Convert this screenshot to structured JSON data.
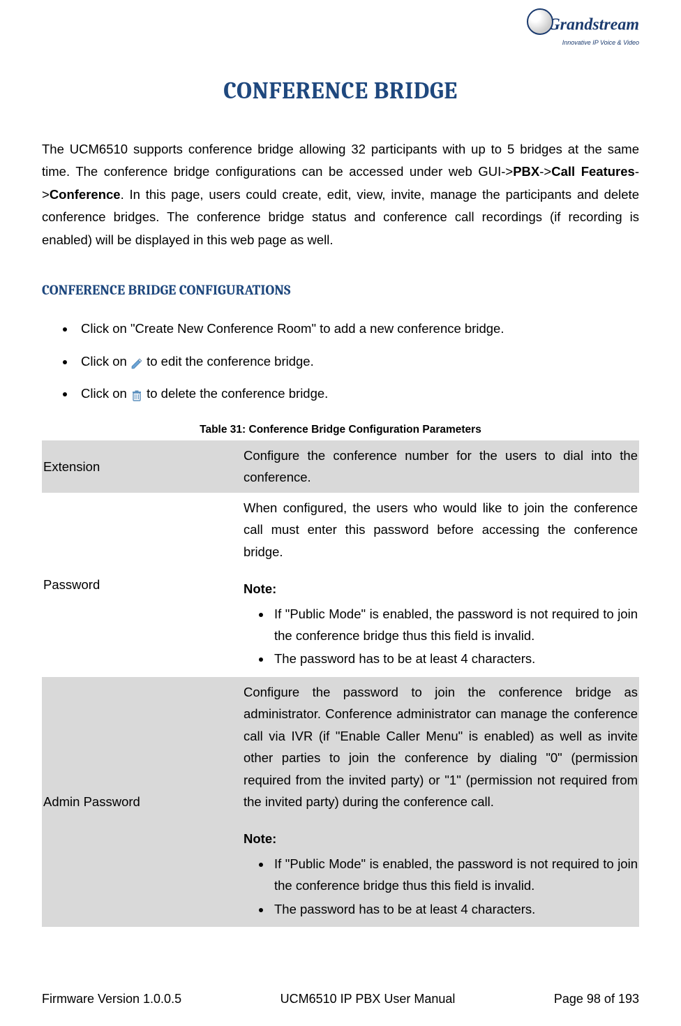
{
  "logo": {
    "brand": "Grandstream",
    "tag": "Innovative IP Voice & Video"
  },
  "title": "CONFERENCE BRIDGE",
  "intro": {
    "raw": "The UCM6510 supports conference bridge allowing 32 participants with up to 5 bridges at the same time. The conference bridge configurations can be accessed under web GUI->PBX->Call Features->Conference. In this page, users could create, edit, view, invite, manage the participants and delete conference bridges. The conference bridge status and conference call recordings (if recording is enabled) will be displayed in this web page as well."
  },
  "section_head": "CONFERENCE BRIDGE CONFIGURATIONS",
  "bullets": {
    "b1": "Click on \"Create New Conference Room\" to add a new conference bridge.",
    "b2_pre": "Click on ",
    "b2_post": " to edit the conference bridge.",
    "b3_pre": "Click on ",
    "b3_post": " to delete the conference bridge."
  },
  "table_caption": "Table 31: Conference Bridge Configuration Parameters",
  "rows": {
    "extension": {
      "label": "Extension",
      "desc": "Configure the conference number for the users to dial into the conference."
    },
    "password": {
      "label": "Password",
      "p1": "When configured, the users who would like to join the conference call must enter this password before accessing the conference bridge.",
      "note_label": "Note:",
      "n1": "If \"Public Mode\" is enabled, the password is not required to join the conference bridge thus this field is invalid.",
      "n2": "The password has to be at least 4 characters."
    },
    "admin": {
      "label": "Admin Password",
      "p1": "Configure the password to join the conference bridge as administrator. Conference administrator can manage the conference call via IVR (if \"Enable Caller Menu\" is enabled) as well as invite other parties to join the conference by dialing \"0\" (permission required from the invited party) or \"1\" (permission not required from the invited party) during the conference call.",
      "note_label": "Note:",
      "n1": "If \"Public Mode\" is enabled, the password is not required to join the conference bridge thus this field is invalid.",
      "n2": "The password has to be at least 4 characters."
    }
  },
  "footer": {
    "left": "Firmware Version 1.0.0.5",
    "center": "UCM6510 IP PBX User Manual",
    "right": "Page 98 of 193"
  },
  "nav": {
    "path_prefix": "The UCM6510 supports conference bridge allowing 32 participants with up to 5 bridges at the same time. The conference bridge configurations can be accessed under web GUI->",
    "pbx": "PBX",
    "arrow": "->",
    "call_features": "Call Features",
    "conference": "Conference",
    "path_suffix": ". In this page, users could create, edit, view, invite, manage the participants and delete conference bridges. The conference bridge status and conference call recordings (if recording is enabled) will be displayed in this web page as well."
  }
}
